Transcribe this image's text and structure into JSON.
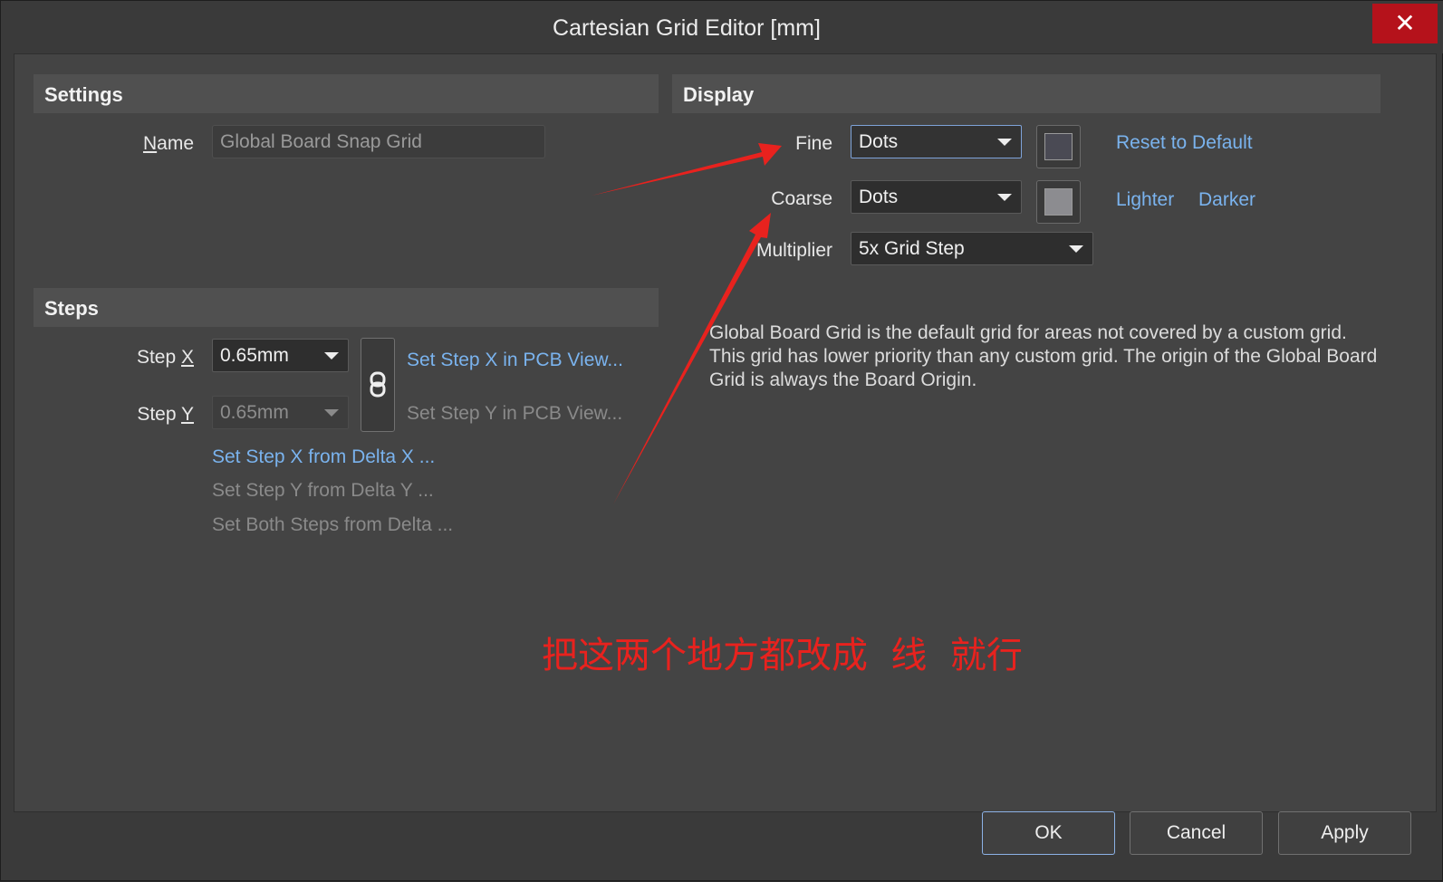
{
  "window": {
    "title": "Cartesian Grid Editor [mm]",
    "close_glyph": "✕"
  },
  "settings": {
    "header": "Settings",
    "name_label_u": "N",
    "name_label_rest": "ame",
    "name_value": "Global Board Snap Grid"
  },
  "steps": {
    "header": "Steps",
    "step_x_label": "Step ",
    "step_x_key": "X",
    "step_x_value": "0.65mm",
    "step_y_label": "Step ",
    "step_y_key": "Y",
    "step_y_value": "0.65mm",
    "link_icon": "link-icon",
    "set_x_pcb": "Set Step X in PCB View...",
    "set_y_pcb": "Set Step Y in PCB View...",
    "set_x_delta": "Set Step X from Delta X ...",
    "set_y_delta": "Set Step Y from Delta Y ...",
    "set_both_delta": "Set Both Steps from Delta ..."
  },
  "display": {
    "header": "Display",
    "fine_label": "Fine",
    "fine_value": "Dots",
    "fine_color": "#4a4a54",
    "coarse_label": "Coarse",
    "coarse_value": "Dots",
    "coarse_color": "#8c8c90",
    "multiplier_label": "Multiplier",
    "multiplier_value": "5x Grid Step",
    "reset": "Reset to Default",
    "lighter": "Lighter",
    "darker": "Darker",
    "description": "Global Board Grid is the default grid for areas not covered by a custom grid. This grid has lower priority than any custom grid. The origin of the Global Board Grid is always the Board Origin."
  },
  "annotation": {
    "text": "把这两个地方都改成  线  就行",
    "color": "#e8221e"
  },
  "buttons": {
    "ok": "OK",
    "cancel": "Cancel",
    "apply": "Apply"
  }
}
